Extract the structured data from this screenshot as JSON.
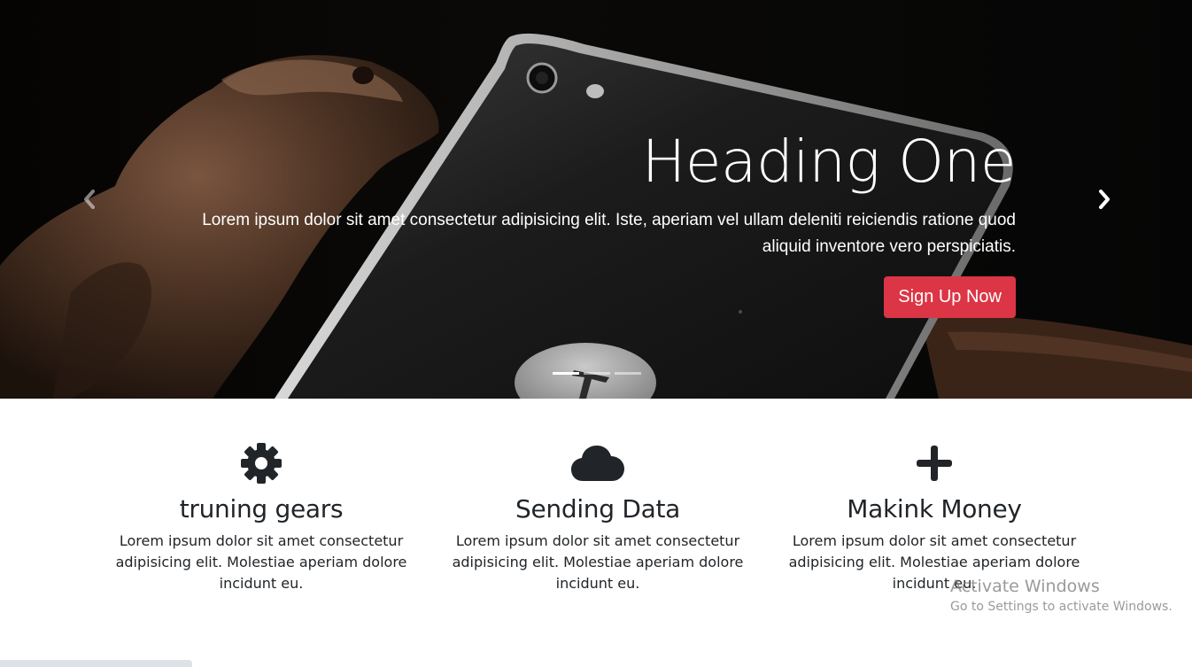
{
  "hero": {
    "heading": "Heading One",
    "text": "Lorem ipsum dolor sit amet consectetur adipisicing elit. Iste, aperiam vel ullam deleniti reiciendis ratione quod aliquid inventore vero perspiciatis.",
    "button_label": "Sign Up Now",
    "prev_icon": "chevron-left-icon",
    "next_icon": "chevron-right-icon",
    "indicators": 3,
    "active_slide": 1,
    "button_color": "#dc3545"
  },
  "features": [
    {
      "icon": "gear-icon",
      "title": "truning gears",
      "text": "Lorem ipsum dolor sit amet consectetur adipisicing elit. Molestiae aperiam dolore incidunt eu."
    },
    {
      "icon": "cloud-icon",
      "title": "Sending Data",
      "text": "Lorem ipsum dolor sit amet consectetur adipisicing elit. Molestiae aperiam dolore incidunt eu."
    },
    {
      "icon": "plus-icon",
      "title": "Makink Money",
      "text": "Lorem ipsum dolor sit amet consectetur adipisicing elit. Molestiae aperiam dolore incidunt eu."
    }
  ],
  "watermark": {
    "title": "Activate Windows",
    "subtitle": "Go to Settings to activate Windows."
  }
}
